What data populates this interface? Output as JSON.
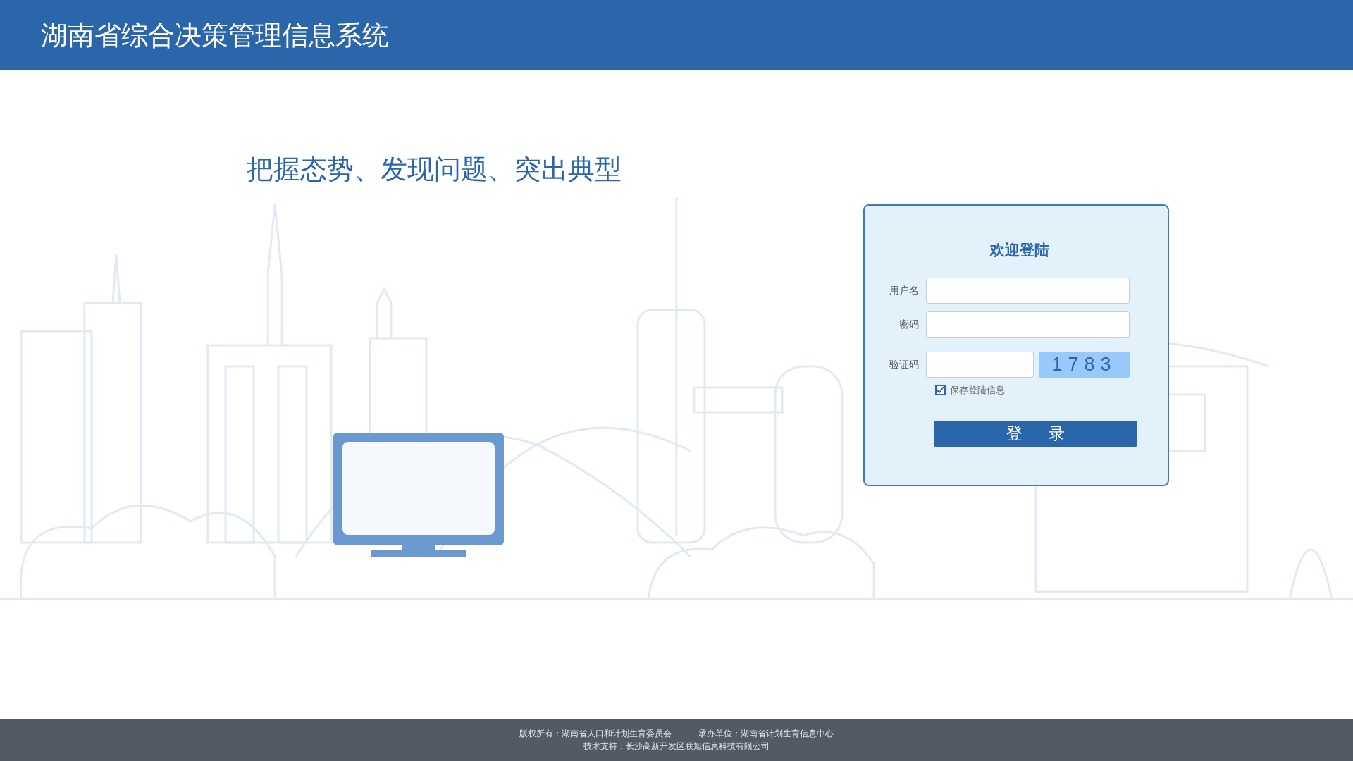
{
  "header": {
    "title": "湖南省综合决策管理信息系统"
  },
  "slogan": "把握态势、发现问题、突出典型",
  "login": {
    "title": "欢迎登陆",
    "fields": [
      {
        "label": "用户名",
        "kind": "text"
      },
      {
        "label": "密码",
        "kind": "password"
      },
      {
        "label": "验证码",
        "kind": "captcha",
        "code": "1783"
      }
    ],
    "remember": {
      "label": "保存登陆信息",
      "checked": true
    },
    "button": "登 录"
  },
  "footer": {
    "lines": [
      [
        "版权所有：湖南省人口和计划生育委员会",
        "承办单位：湖南省计划生育信息中心"
      ],
      [
        "技术支持：长沙高新开发区联旭信息科技有限公司"
      ]
    ]
  }
}
